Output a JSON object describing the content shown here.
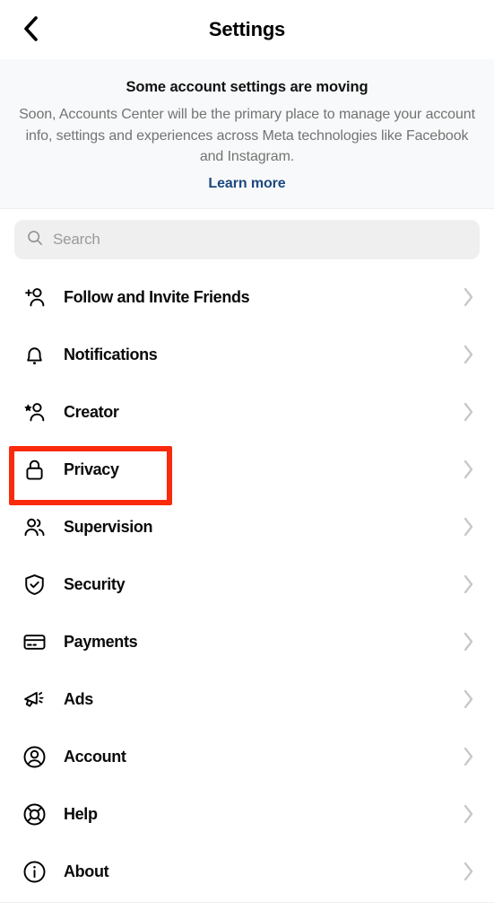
{
  "header": {
    "title": "Settings",
    "back_icon": "chevron-left-icon"
  },
  "banner": {
    "title": "Some account settings are moving",
    "body": "Soon, Accounts Center will be the primary place to manage your account info, settings and experiences across Meta technologies like Facebook and Instagram.",
    "link_label": "Learn more",
    "link_color": "#1c4980",
    "background": "#f8f9fa"
  },
  "search": {
    "placeholder": "Search",
    "value": "",
    "icon": "search-icon",
    "background": "#efefef"
  },
  "list": {
    "chevron_icon": "chevron-right-icon",
    "chevron_color": "#c7c7c7",
    "items": [
      {
        "label": "Follow and Invite Friends",
        "icon": "person-add-icon"
      },
      {
        "label": "Notifications",
        "icon": "bell-icon"
      },
      {
        "label": "Creator",
        "icon": "person-star-icon"
      },
      {
        "label": "Privacy",
        "icon": "lock-icon"
      },
      {
        "label": "Supervision",
        "icon": "people-icon"
      },
      {
        "label": "Security",
        "icon": "shield-check-icon"
      },
      {
        "label": "Payments",
        "icon": "credit-card-icon"
      },
      {
        "label": "Ads",
        "icon": "megaphone-icon"
      },
      {
        "label": "Account",
        "icon": "account-circle-icon"
      },
      {
        "label": "Help",
        "icon": "lifebuoy-icon"
      },
      {
        "label": "About",
        "icon": "info-circle-icon"
      }
    ]
  },
  "annotation": {
    "target_label": "Privacy",
    "color": "#fa2a0d"
  }
}
